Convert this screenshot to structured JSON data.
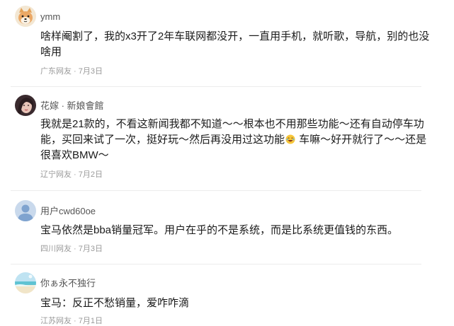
{
  "comments": [
    {
      "username": "ymm",
      "avatar_icon": "shiba-dog-avatar-icon",
      "text": "啥样阉割了，我的x3开了2年车联网都没开，一直用手机，就听歌，导航，别的也没啥用",
      "region": "广东网友",
      "date": "7月3日"
    },
    {
      "username": "花嫁 · 新娘會館",
      "avatar_icon": "portrait-photo-avatar-icon",
      "text_before_emoji": "我就是21款的，不看这新闻我都不知道～～根本也不用那些功能～还有自动停车功能，买回来试了一次，挺好玩～然后再没用过这功能",
      "emoji_icon": "laughing-emoji-icon",
      "text_after_emoji": " 车嘛～好开就行了～～还是很喜欢BMW～",
      "region": "辽宁网友",
      "date": "7月2日"
    },
    {
      "username": "用户cwd60oe",
      "avatar_icon": "default-user-avatar-icon",
      "text": "宝马依然是bba销量冠军。用户在乎的不是系统，而是比系统更值钱的东西。",
      "region": "四川网友",
      "date": "7月3日"
    },
    {
      "username": "你ぁ永不独行",
      "avatar_icon": "ocean-scenery-avatar-icon",
      "text": "宝马：反正不愁销量，爱咋咋滴",
      "region": "江苏网友",
      "date": "7月1日"
    }
  ],
  "meta_separator": " · ",
  "colors": {
    "username": "#555555",
    "body": "#1a1a1a",
    "meta": "#9a9a9a",
    "divider": "#ececec"
  }
}
